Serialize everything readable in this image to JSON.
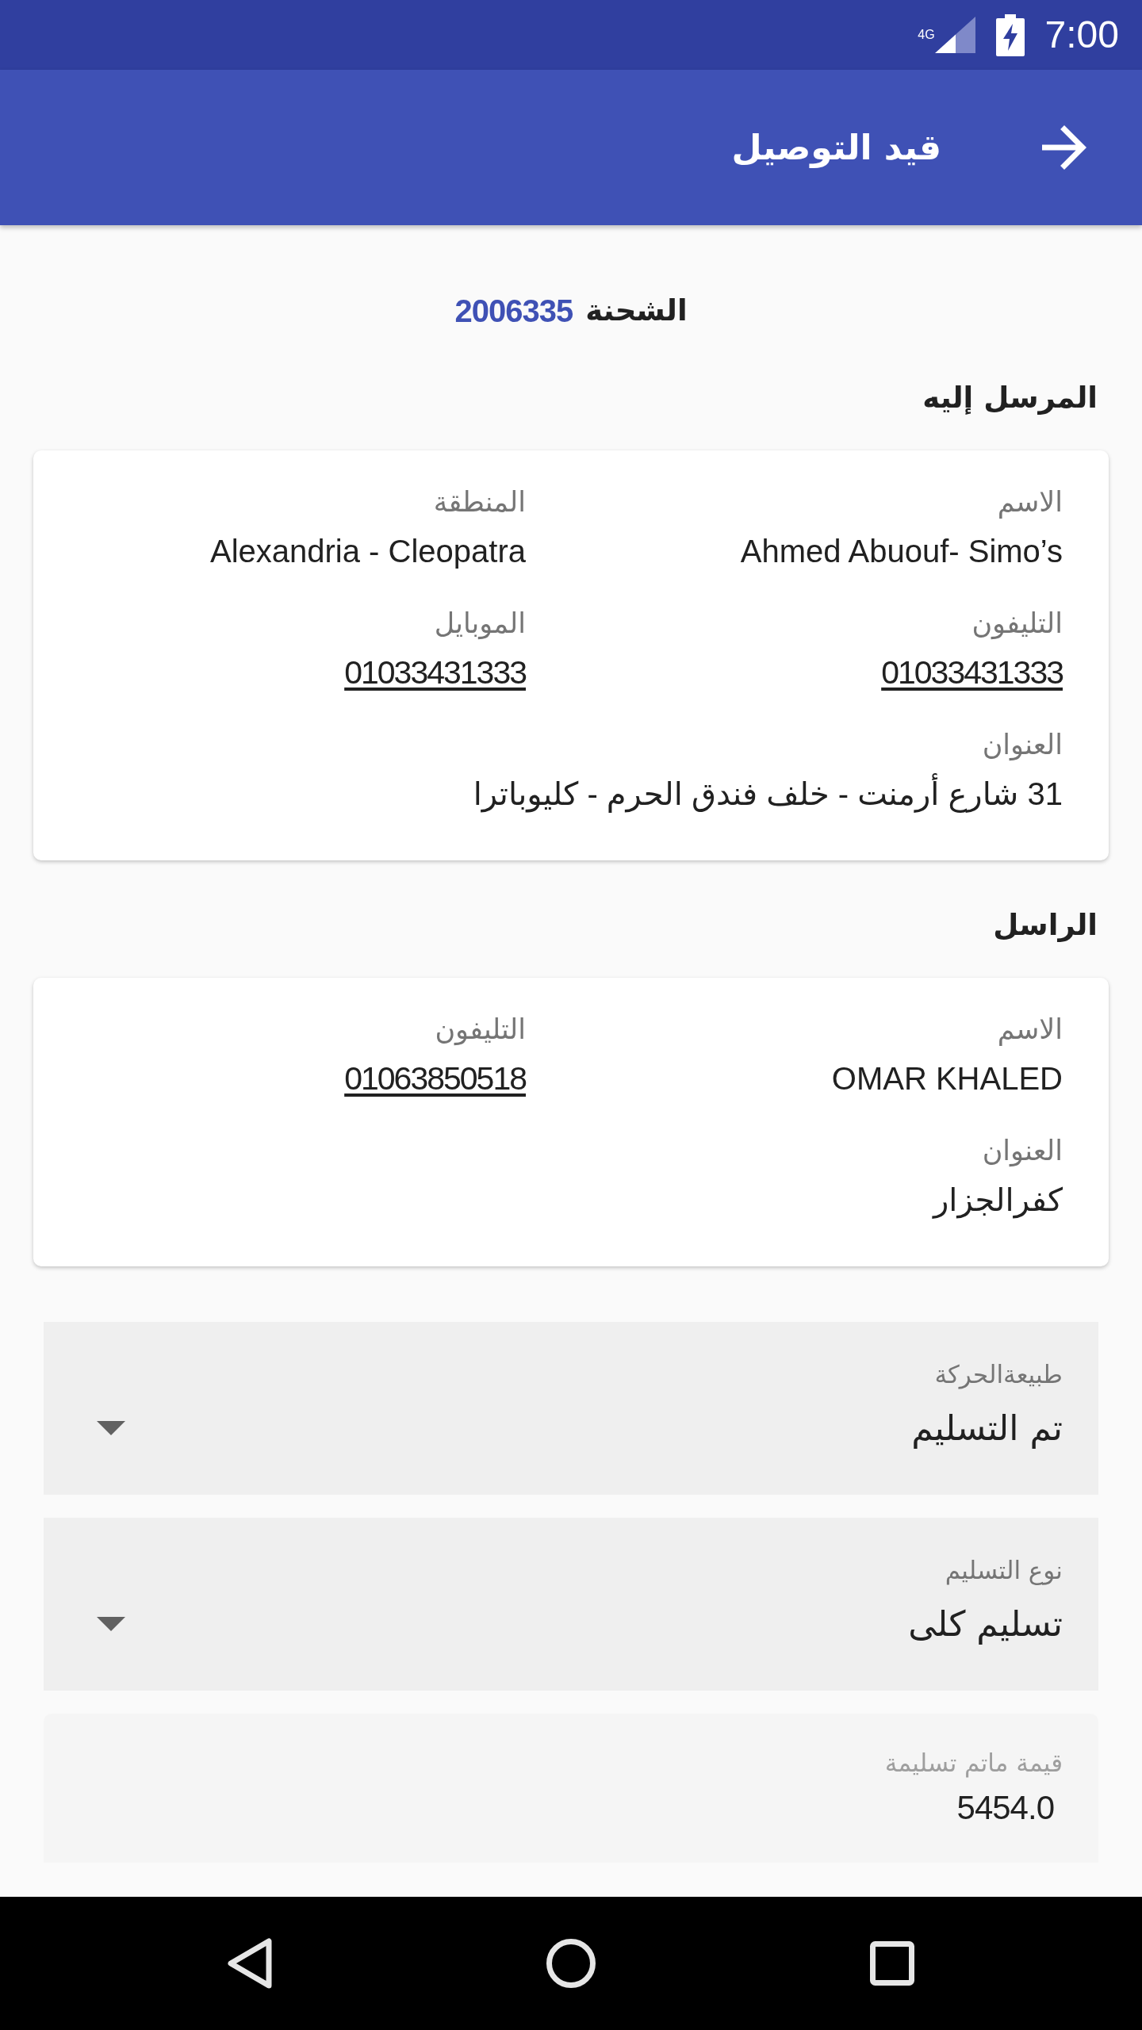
{
  "status_bar": {
    "network": "4G",
    "time": "7:00"
  },
  "app_bar": {
    "title": "قيد التوصيل"
  },
  "shipment": {
    "label": "الشحنة",
    "number": "2006335"
  },
  "sections": [
    {
      "heading": "المرسل إليه",
      "fields": [
        {
          "kind": "text",
          "label": "الاسم",
          "value": "Ahmed Abuouf- Simo’s"
        },
        {
          "kind": "text",
          "label": "المنطقة",
          "value": "Alexandria - Cleopatra"
        },
        {
          "kind": "phone",
          "label": "التليفون",
          "value": "01033431333"
        },
        {
          "kind": "phone",
          "label": "الموبايل",
          "value": "01033431333"
        },
        {
          "kind": "address",
          "label": "العنوان",
          "value": "31 شارع أرمنت - خلف فندق الحرم - كليوباترا"
        }
      ]
    },
    {
      "heading": "الراسل",
      "fields": [
        {
          "kind": "text",
          "label": "الاسم",
          "value": "OMAR KHALED"
        },
        {
          "kind": "phone",
          "label": "التليفون",
          "value": "01063850518"
        },
        {
          "kind": "address",
          "label": "العنوان",
          "value": "كفرالجزار"
        }
      ]
    }
  ],
  "form": [
    {
      "kind": "dropdown",
      "label": "طبيعةالحركة",
      "value": "تم التسليم"
    },
    {
      "kind": "dropdown",
      "label": "نوع التسليم",
      "value": "تسليم كلى"
    },
    {
      "kind": "input",
      "label": "قيمة ماتم تسليمة",
      "value": "5454.0"
    }
  ]
}
